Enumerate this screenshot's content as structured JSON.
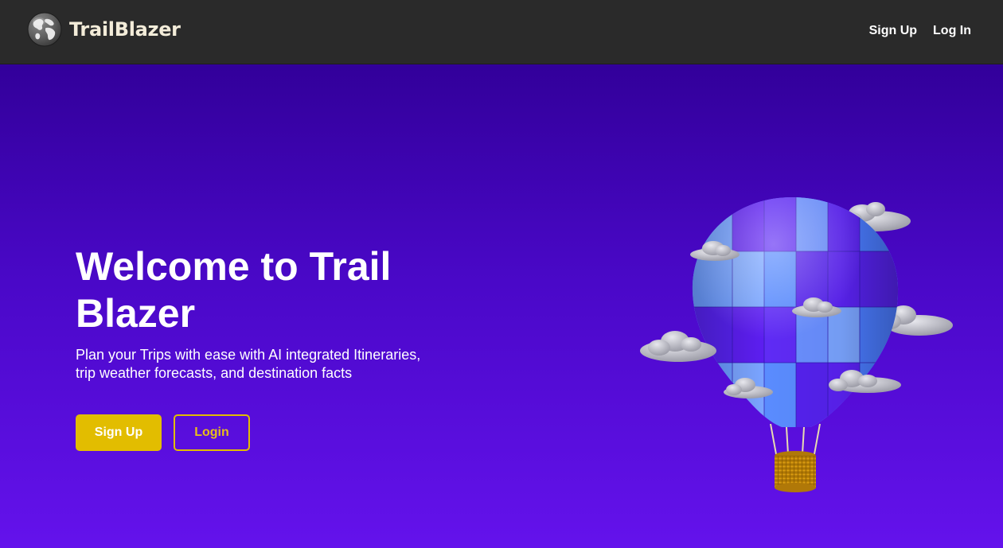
{
  "navbar": {
    "brand_name": "TrailBlazer",
    "logo_icon": "globe-icon",
    "links": [
      {
        "label": "Sign Up"
      },
      {
        "label": "Log In"
      }
    ]
  },
  "hero": {
    "title": "Welcome to Trail Blazer",
    "subtitle": "Plan your Trips with ease with AI integrated Itineraries, trip weather forecasts, and destination facts",
    "primary_button": "Sign Up",
    "secondary_button": "Login",
    "illustration": "hot-air-balloon-with-clouds"
  },
  "colors": {
    "navbar_bg": "#2a2a2a",
    "brand_text": "#f3ecd9",
    "hero_gradient_top": "#32009a",
    "hero_gradient_bottom": "#6412ec",
    "accent_gold": "#e2bd00",
    "balloon_light": "#5b8cff",
    "balloon_dark": "#5a1ff0"
  }
}
